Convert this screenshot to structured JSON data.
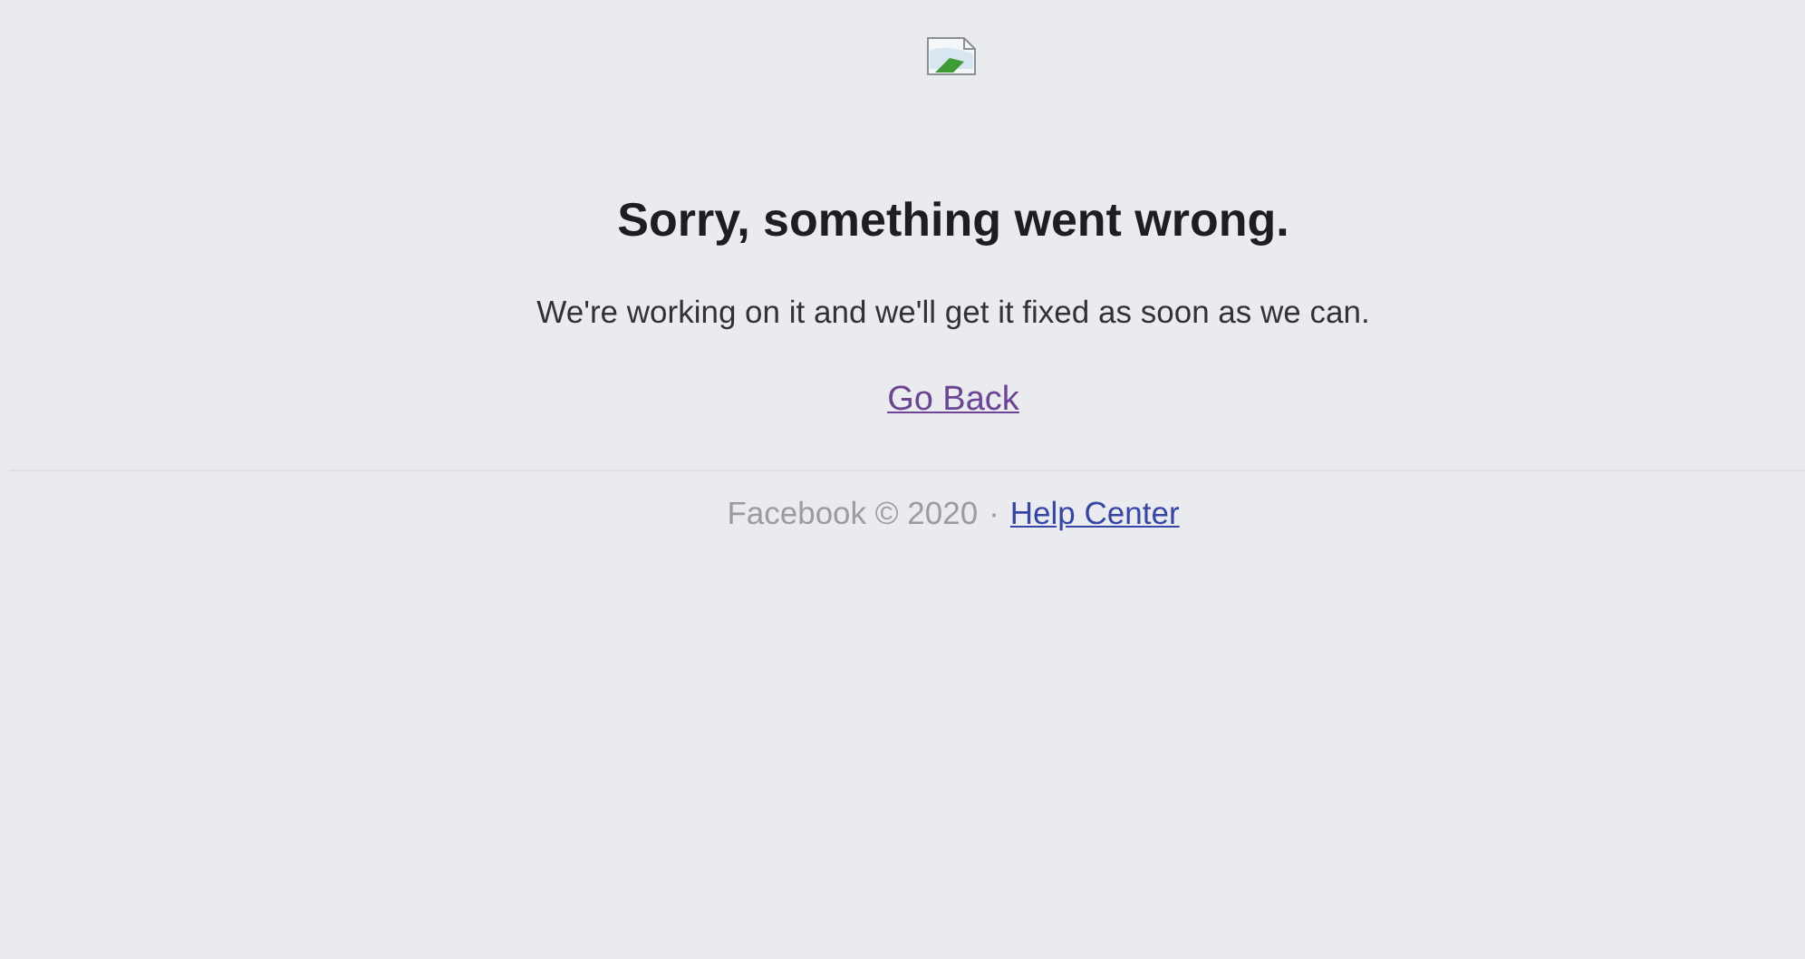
{
  "error": {
    "title": "Sorry, something went wrong.",
    "message": "We're working on it and we'll get it fixed as soon as we can.",
    "link": {
      "label": "Go Back",
      "visited": true
    }
  },
  "footer": {
    "copyright": "Facebook © 2020",
    "separator": "·",
    "link": {
      "label": "Help Center",
      "visited": false
    }
  }
}
